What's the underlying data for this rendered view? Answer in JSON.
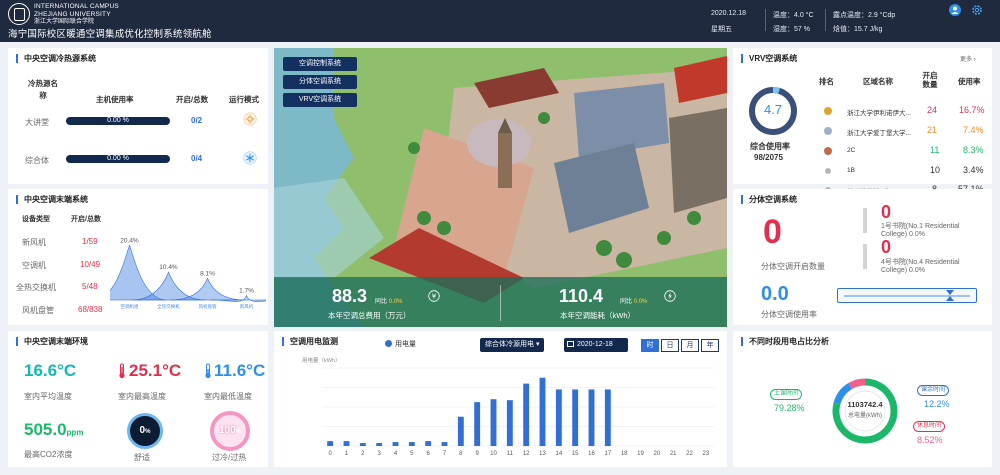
{
  "header": {
    "brand_line1": "INTERNATIONAL CAMPUS",
    "brand_line2": "ZHEJIANG  UNIVERSITY",
    "brand_cn": "浙江大学国际联合学院",
    "title": "海宁国际校区暖通空调集成优化控制系统领航舱",
    "date": "2020.12.18",
    "weekday": "星期五",
    "temp": "温度：4.0 °C",
    "humidity": "湿度：57 %",
    "dewpoint": "露点温度：2.9 °Cdp",
    "enthalpy": "焓值：15.7 J/kg"
  },
  "cold_source": {
    "title": "中央空调冷热源系统",
    "cols": [
      "冷热源名称",
      "主机使用率",
      "开启/总数",
      "运行模式"
    ],
    "rows": [
      {
        "name": "大讲堂",
        "usage": "0.00 %",
        "open": "0/2",
        "mode": "sun-icon"
      },
      {
        "name": "综合体",
        "usage": "0.00 %",
        "open": "0/4",
        "mode": "snow-icon"
      }
    ]
  },
  "terminal": {
    "title": "中央空调末端系统",
    "cols": [
      "设备类型",
      "开启/总数"
    ],
    "rows": [
      {
        "name": "新风机",
        "value": "1/59"
      },
      {
        "name": "空调机",
        "value": "10/49"
      },
      {
        "name": "全热交换机",
        "value": "5/48"
      },
      {
        "name": "风机盘管",
        "value": "68/838"
      }
    ],
    "chart_data": {
      "type": "area",
      "categories": [
        "空调机组",
        "全热交换机",
        "风机盘管",
        "新风机"
      ],
      "values": [
        20.4,
        10.4,
        8.1,
        1.7
      ],
      "labels": [
        "20.4%",
        "10.4%",
        "8.1%",
        "1.7%"
      ],
      "ylim": [
        0,
        25
      ]
    }
  },
  "environment": {
    "title": "中央空调末端环境",
    "avg_temp": "16.6°C",
    "avg_temp_label": "室内平均温度",
    "max_temp": "25.1°C",
    "max_temp_label": "室内最高温度",
    "min_temp": "11.6°C",
    "min_temp_label": "室内最低温度",
    "co2": "505.0",
    "co2_unit": "ppm",
    "co2_label": "最高CO2浓度",
    "comfort": "0",
    "comfort_unit": "%",
    "comfort_label": "舒适",
    "overheat": "100",
    "overheat_unit": "%",
    "overheat_label": "过冷/过热"
  },
  "map": {
    "menu": [
      "空调控制系统",
      "分体空调系统",
      "VRV空调系统"
    ],
    "cost_value": "88.3",
    "cost_change_prefix": "同比",
    "cost_change": "0.0%",
    "cost_label": "本年空调总费用（万元）",
    "energy_value": "110.4",
    "energy_change_prefix": "同比",
    "energy_change": "0.0%",
    "energy_label": "本年空调能耗（kWh）"
  },
  "vrv": {
    "title": "VRV空调系统",
    "more": "更多 ›",
    "usage_ring": "4.7",
    "usage_ring_fraction": 0.047,
    "usage_label": "综合使用率",
    "usage_count": "98/2075",
    "cols": [
      "排名",
      "区域名称",
      "开启数量",
      "使用率"
    ],
    "rows": [
      {
        "name": "浙江大学伊利诺伊大...",
        "count": "24",
        "rate": "16.7%",
        "color": "#e0304e"
      },
      {
        "name": "浙江大学爱丁堡大学...",
        "count": "21",
        "rate": "7.4%",
        "color": "#f08a24"
      },
      {
        "name": "2C",
        "count": "11",
        "rate": "8.3%",
        "color": "#1cb86a"
      },
      {
        "name": "1B",
        "count": "10",
        "rate": "3.4%",
        "color": "#333333"
      },
      {
        "name": "基础教学楼B栋(Lear...",
        "count": "8",
        "rate": "57.1%",
        "color": "#333333"
      }
    ]
  },
  "split": {
    "title": "分体空调系统",
    "open_count": "0",
    "open_label": "分体空调开启数量",
    "usage": "0.0",
    "usage_label": "分体空调使用率",
    "items": [
      {
        "count": "0",
        "name": "1号书院(No.1 Residential College) 0.0%"
      },
      {
        "count": "0",
        "name": "4号书院(No.4 Residential College) 0.0%"
      }
    ]
  },
  "power": {
    "title": "空调用电监测",
    "legend": "用电量",
    "dropdown": "综合体冷源用电",
    "date": "2020-12-18",
    "tabs": [
      "时",
      "日",
      "月",
      "年"
    ],
    "chart_data": {
      "type": "bar",
      "ylabel": "用电量（kWh）",
      "categories": [
        "0",
        "1",
        "2",
        "3",
        "4",
        "5",
        "6",
        "7",
        "8",
        "9",
        "10",
        "11",
        "12",
        "13",
        "14",
        "15",
        "16",
        "17",
        "18",
        "19",
        "20",
        "21",
        "22",
        "23"
      ],
      "values": [
        5,
        5,
        3,
        3,
        4,
        4,
        5,
        4,
        30,
        45,
        48,
        47,
        64,
        70,
        58,
        58,
        58,
        58,
        0,
        0,
        0,
        0,
        0,
        0
      ],
      "ylim": [
        0,
        80
      ]
    }
  },
  "ratio": {
    "title": "不同时段用电占比分析",
    "total": "1103742.4",
    "total_label": "总电量(kWh)",
    "chart_data": {
      "type": "pie",
      "categories": [
        "上课时间",
        "课余时间",
        "休息时间"
      ],
      "values": [
        79.28,
        12.2,
        8.52
      ],
      "labels": [
        "79.28%",
        "12.2%",
        "8.52%"
      ]
    }
  }
}
